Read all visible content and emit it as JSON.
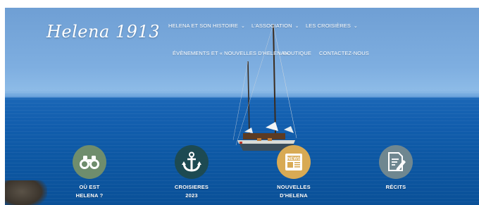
{
  "brand": {
    "logo_text": "Helena 1913"
  },
  "nav": {
    "items": [
      {
        "label": "HELENA ET SON HISTOIRE",
        "has_dropdown": true
      },
      {
        "label": "L'ASSOCIATION",
        "has_dropdown": true
      },
      {
        "label": "LES CROISIÈRES",
        "has_dropdown": true
      },
      {
        "label": "ÉVÈNEMENTS ET « NOUVELLES D'HELENA »",
        "has_dropdown": false
      },
      {
        "label": "BOUTIQUE",
        "has_dropdown": false
      },
      {
        "label": "CONTACTEZ-NOUS",
        "has_dropdown": false
      }
    ],
    "dropdown_glyph": "⌄"
  },
  "features": [
    {
      "label_line1": "OÙ EST",
      "label_line2": "HELENA ?",
      "icon": "binoculars-icon",
      "color": "#6f8d6d"
    },
    {
      "label_line1": "CROISIERES",
      "label_line2": "2023",
      "icon": "anchor-icon",
      "color": "#1d4a52"
    },
    {
      "label_line1": "NOUVELLES",
      "label_line2": "D'HELENA",
      "icon": "newspaper-icon",
      "color": "#d8aa54"
    },
    {
      "label_line1": "RÉCITS",
      "label_line2": "",
      "icon": "document-edit-icon",
      "color": "#6f8790"
    }
  ],
  "colors": {
    "sky": "#7eaee0",
    "sea": "#125eae",
    "text": "#ffffff"
  }
}
